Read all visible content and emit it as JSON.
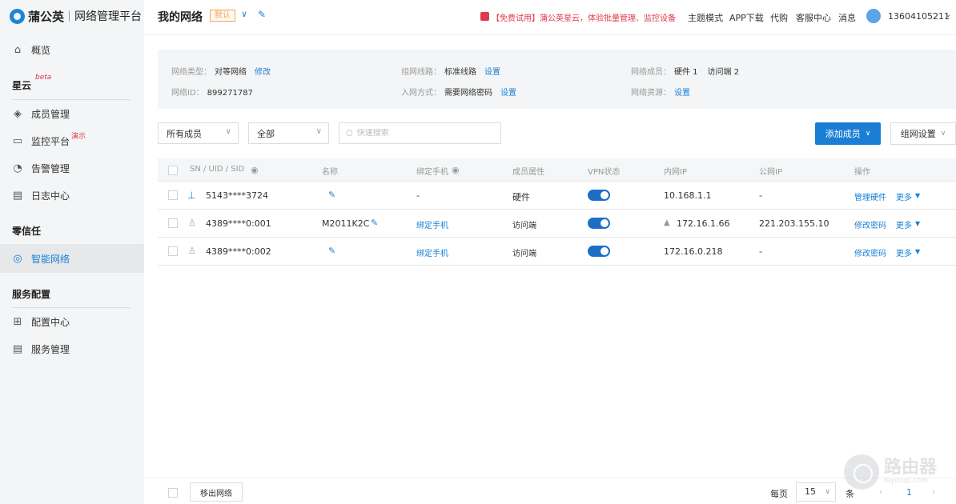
{
  "app": {
    "brand": "蒲公英",
    "subtitle": "网络管理平台"
  },
  "sidebar": {
    "overview": "概览",
    "section1": "星云",
    "section1_badge": "beta",
    "members": "成员管理",
    "monitor": "监控平台",
    "monitor_badge": "演示",
    "alerts": "告警管理",
    "logs": "日志中心",
    "section2": "零信任",
    "smart_network": "智能网络",
    "section3": "服务配置",
    "config_center": "配置中心",
    "service_mgmt": "服务管理"
  },
  "topbar": {
    "title": "我的网络",
    "default_badge": "默认",
    "promo": "【免费试用】蒲公英星云，体验批量管理、监控设备",
    "links": [
      "主题模式",
      "APP下载",
      "代购",
      "客服中心",
      "消息"
    ],
    "user": "13604105211"
  },
  "info": {
    "type_label": "网络类型：",
    "type_value": "对等网络",
    "type_action": "修改",
    "line_label": "组网线路：",
    "line_value": "标准线路",
    "line_action": "设置",
    "members_label": "网络成员：",
    "members_hw": "硬件 1",
    "members_visitor": "访问端 2",
    "id_label": "网络ID：",
    "id_value": "899271787",
    "join_label": "入网方式：",
    "join_value": "需要网络密码",
    "join_action": "设置",
    "resource_label": "网络资源：",
    "resource_action": "设置"
  },
  "filters": {
    "members": "所有成员",
    "status": "全部",
    "search_placeholder": "快速搜索",
    "add_member": "添加成员",
    "network_settings": "组网设置"
  },
  "table": {
    "headers": {
      "sn": "SN / UID / SID",
      "name": "名称",
      "phone": "绑定手机",
      "attr": "成员属性",
      "vpn": "VPN状态",
      "lan_ip": "内网IP",
      "wan_ip": "公网IP",
      "action": "操作"
    },
    "rows": [
      {
        "sn": "5143****3724",
        "name": "",
        "phone": "-",
        "attr": "硬件",
        "vpn": "on",
        "lan_ip": "10.168.1.1",
        "wan_ip": "-",
        "action": "管理硬件",
        "more": "更多"
      },
      {
        "sn": "4389****0:001",
        "name": "M2011K2C",
        "phone": "绑定手机",
        "attr": "访问端",
        "vpn": "on",
        "lan_ip": "172.16.1.66",
        "wan_ip": "221.203.155.10",
        "action": "修改密码",
        "more": "更多"
      },
      {
        "sn": "4389****0:002",
        "name": "",
        "phone": "绑定手机",
        "attr": "访问端",
        "vpn": "on",
        "lan_ip": "172.16.0.218",
        "wan_ip": "-",
        "action": "修改密码",
        "more": "更多"
      }
    ]
  },
  "footer": {
    "export": "移出网络",
    "per_page": "每页",
    "page_size": "15",
    "unit": "条",
    "page": "1"
  },
  "watermark": {
    "cn": "路由器",
    "en": "luyouqi.com"
  }
}
